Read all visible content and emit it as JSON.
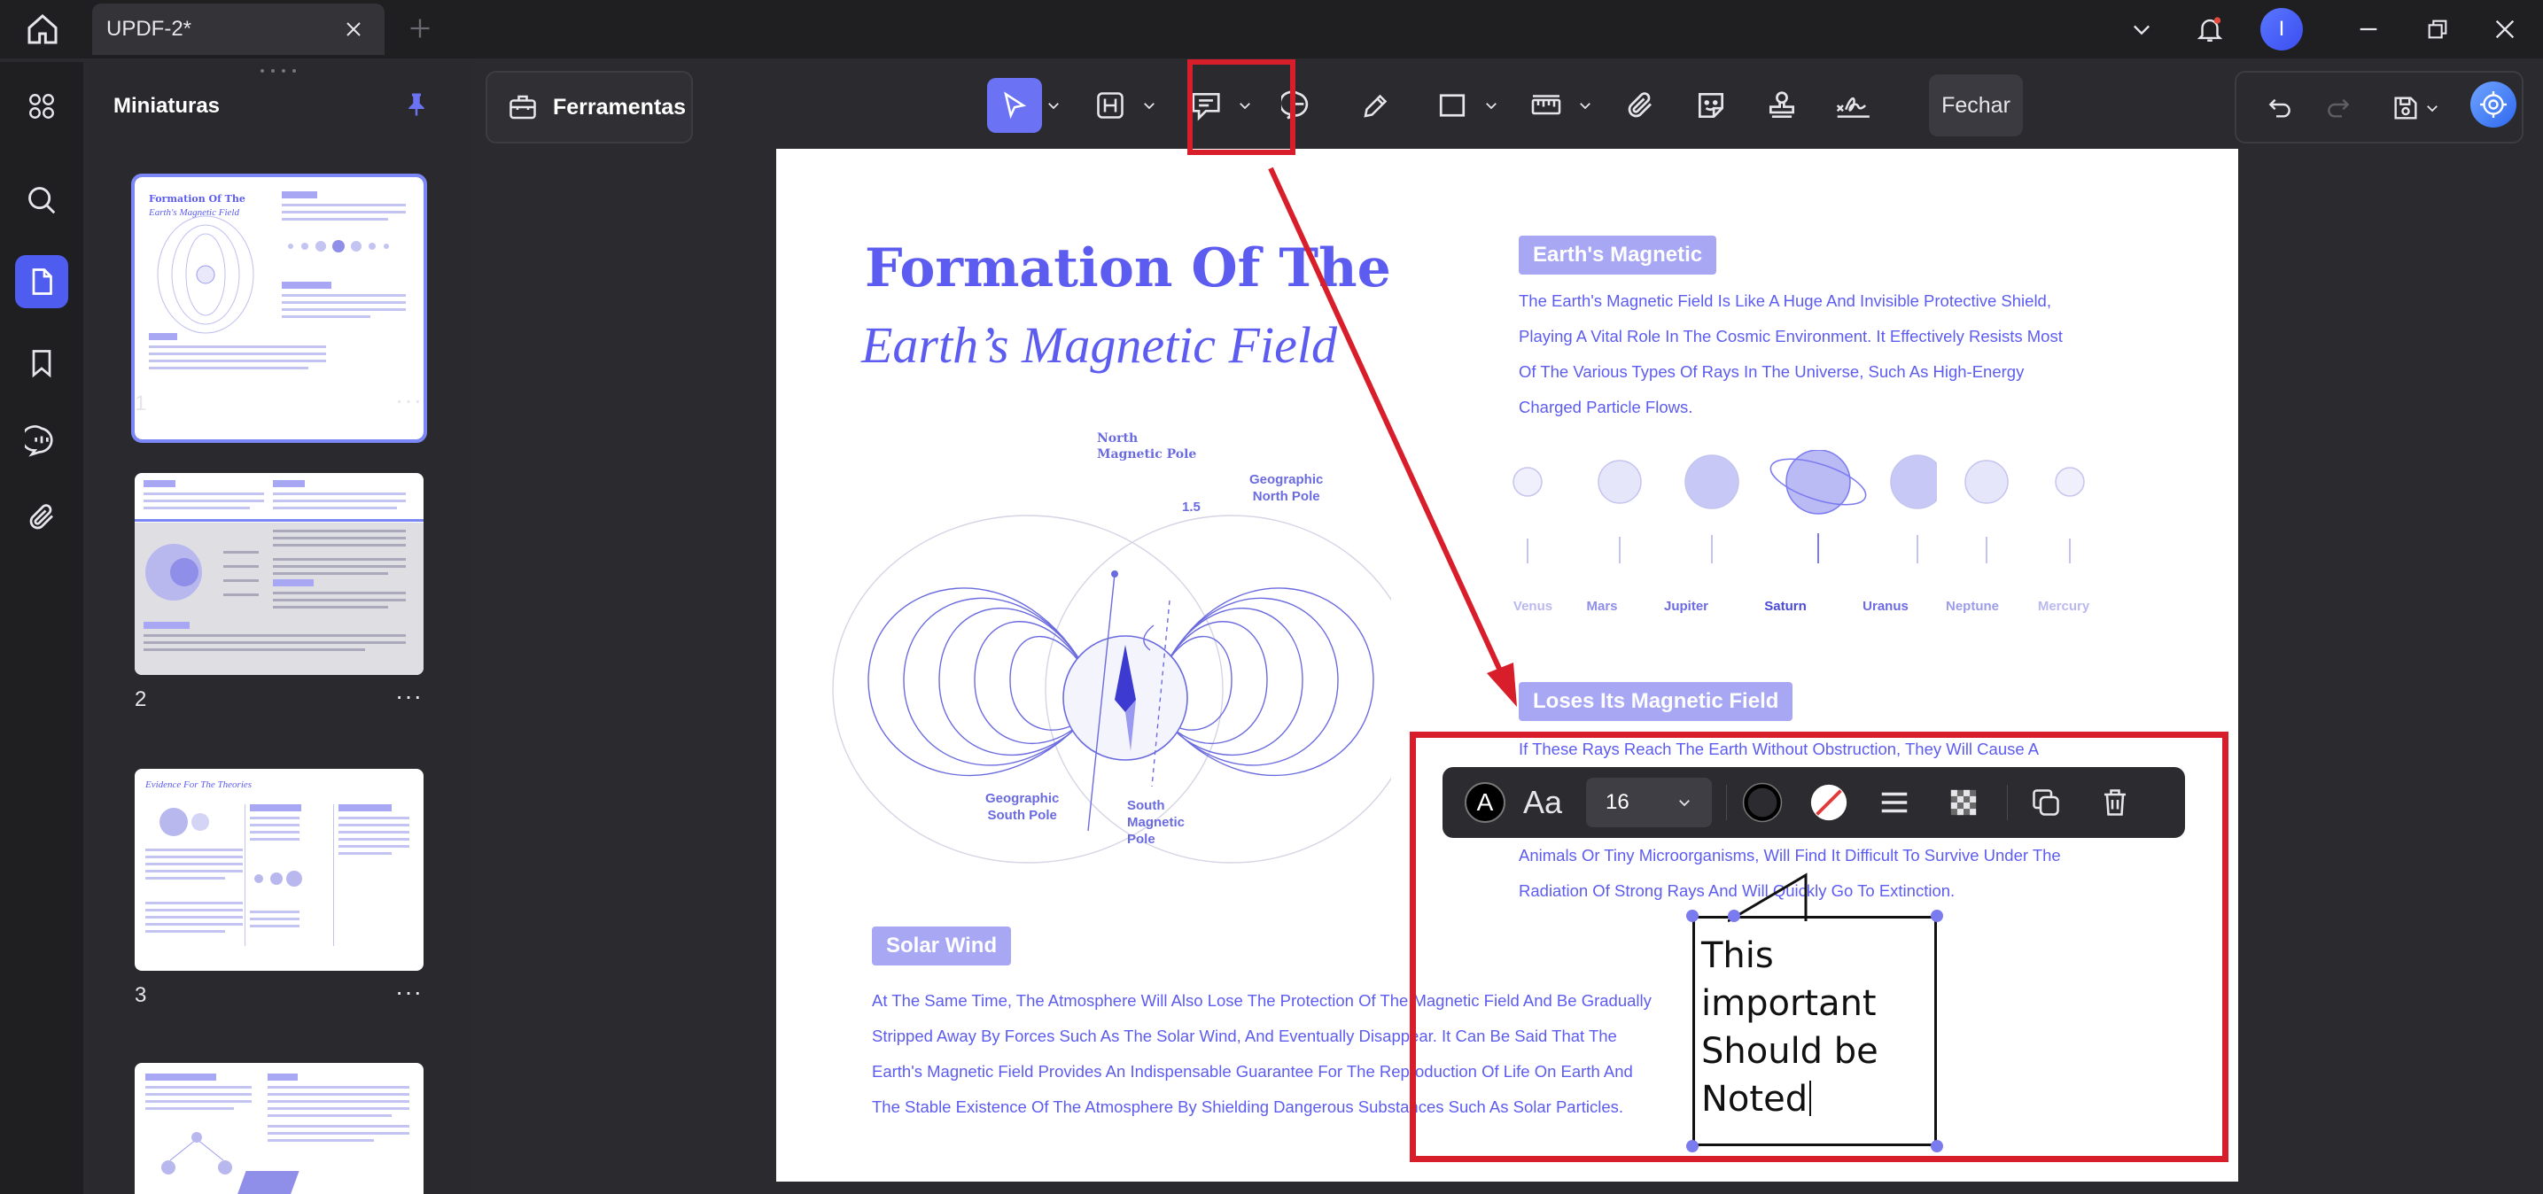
{
  "tab": {
    "title": "UPDF-2*"
  },
  "account": {
    "initial": "I"
  },
  "thumbnails": {
    "title": "Miniaturas",
    "pages": [
      {
        "number": "1",
        "thumb_title": "Formation Of The",
        "thumb_subtitle": "Earth's Magnetic Field"
      },
      {
        "number": "2"
      },
      {
        "number": "3",
        "thumb_title": "Evidence For The Theories"
      }
    ],
    "more": "···"
  },
  "toolbar": {
    "tools_label": "Ferramentas",
    "close_label": "Fechar"
  },
  "document": {
    "title_line1": "Formation Of The",
    "title_line2": "Earth’s Magnetic Field",
    "diagram": {
      "north_magnetic_pole": [
        "North",
        "Magnetic Pole"
      ],
      "geographic_north_pole": [
        "Geographic",
        "North Pole"
      ],
      "angle": "1.5",
      "geographic_south_pole": [
        "Geographic",
        "South Pole"
      ],
      "south_magnetic_pole": [
        "South",
        "Magnetic",
        "Pole"
      ]
    },
    "section1": {
      "heading": "Earth's Magnetic",
      "lines": [
        "The Earth's Magnetic Field Is Like A Huge And Invisible Protective Shield,",
        "Playing A Vital Role In The Cosmic Environment. It Effectively Resists Most",
        "Of The Various Types Of Rays In The Universe, Such As High-Energy",
        "Charged Particle Flows."
      ]
    },
    "planets": [
      {
        "name": "Venus",
        "color": "#b9b9f0"
      },
      {
        "name": "Mars",
        "color": "#8f8ee8"
      },
      {
        "name": "Jupiter",
        "color": "#6c6be4"
      },
      {
        "name": "Saturn",
        "color": "#4b4ad6"
      },
      {
        "name": "Uranus",
        "color": "#6c6be4"
      },
      {
        "name": "Neptune",
        "color": "#9c9ce8"
      },
      {
        "name": "Mercury",
        "color": "#b9b9f0"
      }
    ],
    "section2": {
      "heading": "Loses Its Magnetic Field",
      "lines": [
        "If These Rays Reach The Earth Without Obstruction, They Will Cause A",
        "Animals Or Tiny Microorganisms, Will Find It Difficult To Survive Under The",
        "Radiation Of Strong Rays And Will Quickly Go To Extinction."
      ]
    },
    "section3": {
      "heading": "Solar Wind",
      "lines": [
        "At The Same Time, The Atmosphere Will Also Lose The Protection Of The Magnetic Field And Be Gradually",
        "Stripped Away By Forces Such As The Solar Wind, And Eventually Disappear. It Can Be Said That The",
        "Earth's Magnetic Field Provides An Indispensable Guarantee For The Reproduction Of Life On Earth And",
        "The Stable Existence Of The Atmosphere By Shielding Dangerous Substances Such As Solar Particles."
      ]
    }
  },
  "format_bar": {
    "font_size": "16",
    "font_glyph": "Aa",
    "color_glyph": "A"
  },
  "annotation": {
    "lines": [
      "This",
      "important",
      "Should be",
      "Noted"
    ]
  },
  "colors": {
    "accent": "#6b73f4",
    "highlight": "#d81e2a",
    "doc_text": "#5d5cf0"
  }
}
